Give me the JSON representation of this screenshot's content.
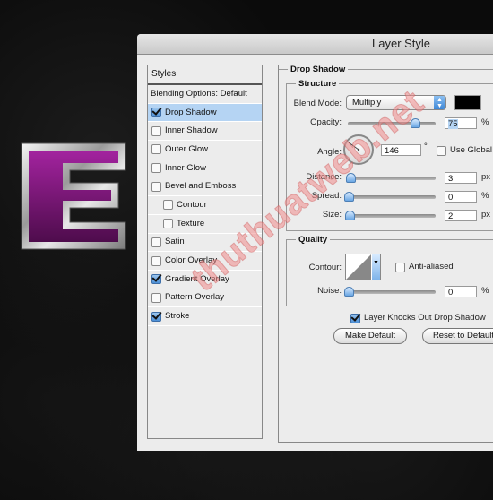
{
  "dialog": {
    "title": "Layer Style"
  },
  "styles_panel": {
    "header": "Styles",
    "items": [
      {
        "label": "Blending Options: Default",
        "type": "header",
        "checked": null,
        "selected": false
      },
      {
        "label": "Drop Shadow",
        "type": "item",
        "checked": true,
        "selected": true
      },
      {
        "label": "Inner Shadow",
        "type": "item",
        "checked": false,
        "selected": false
      },
      {
        "label": "Outer Glow",
        "type": "item",
        "checked": false,
        "selected": false
      },
      {
        "label": "Inner Glow",
        "type": "item",
        "checked": false,
        "selected": false
      },
      {
        "label": "Bevel and Emboss",
        "type": "item",
        "checked": false,
        "selected": false
      },
      {
        "label": "Contour",
        "type": "sub",
        "checked": false,
        "selected": false
      },
      {
        "label": "Texture",
        "type": "sub",
        "checked": false,
        "selected": false
      },
      {
        "label": "Satin",
        "type": "item",
        "checked": false,
        "selected": false
      },
      {
        "label": "Color Overlay",
        "type": "item",
        "checked": false,
        "selected": false
      },
      {
        "label": "Gradient Overlay",
        "type": "item",
        "checked": true,
        "selected": false
      },
      {
        "label": "Pattern Overlay",
        "type": "item",
        "checked": false,
        "selected": false
      },
      {
        "label": "Stroke",
        "type": "item",
        "checked": true,
        "selected": false
      }
    ]
  },
  "drop_shadow": {
    "section_title": "Drop Shadow",
    "structure": {
      "title": "Structure",
      "blend_mode_label": "Blend Mode:",
      "blend_mode_value": "Multiply",
      "shadow_color": "#000000",
      "opacity_label": "Opacity:",
      "opacity_value": "75",
      "opacity_unit": "%",
      "angle_label": "Angle:",
      "angle_value": "146",
      "angle_unit": "°",
      "use_global_label": "Use Global",
      "use_global_checked": false,
      "distance_label": "Distance:",
      "distance_value": "3",
      "distance_unit": "px",
      "spread_label": "Spread:",
      "spread_value": "0",
      "spread_unit": "%",
      "size_label": "Size:",
      "size_value": "2",
      "size_unit": "px"
    },
    "quality": {
      "title": "Quality",
      "contour_label": "Contour:",
      "anti_aliased_label": "Anti-aliased",
      "anti_aliased_checked": false,
      "noise_label": "Noise:",
      "noise_value": "0",
      "noise_unit": "%"
    },
    "knocks_out_label": "Layer Knocks Out Drop Shadow",
    "knocks_out_checked": true,
    "make_default_label": "Make Default",
    "reset_default_label": "Reset to Default"
  },
  "artwork": {
    "letter": "E",
    "fill_color": "#8b1a8a",
    "stroke_color": "#c8c8c8"
  },
  "watermark": "thuthuatweb.net"
}
